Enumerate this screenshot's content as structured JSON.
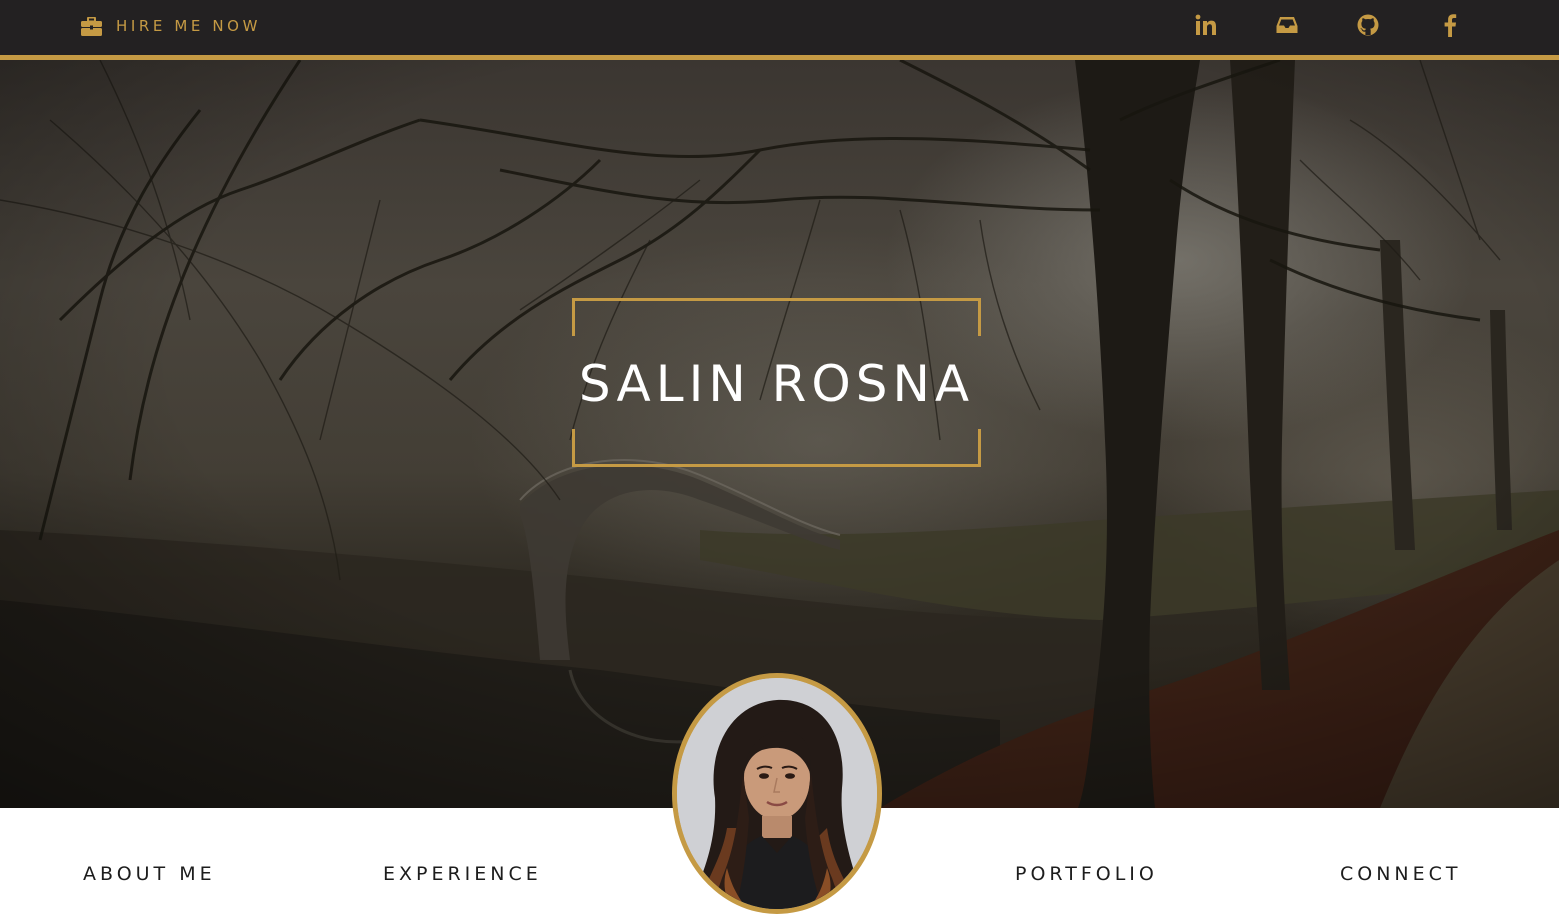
{
  "topbar": {
    "hire_label": "HIRE ME NOW",
    "hire_icon": "briefcase-icon",
    "social": [
      {
        "name": "linkedin",
        "icon": "linkedin-icon"
      },
      {
        "name": "inbox",
        "icon": "inbox-icon"
      },
      {
        "name": "github",
        "icon": "github-icon"
      },
      {
        "name": "facebook",
        "icon": "facebook-icon"
      }
    ]
  },
  "hero": {
    "title": "SALIN ROSNA"
  },
  "nav": {
    "about": "ABOUT ME",
    "experience": "EXPERIENCE",
    "portfolio": "PORTFOLIO",
    "connect": "CONNECT"
  },
  "colors": {
    "accent": "#c59a44",
    "topbar_bg": "#232122",
    "nav_text": "#1d1d1d",
    "hero_title": "#ffffff"
  }
}
